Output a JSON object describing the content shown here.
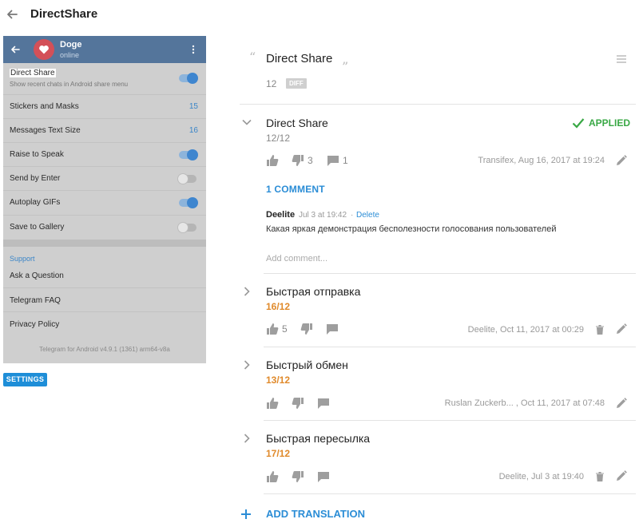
{
  "header": {
    "title": "DirectShare"
  },
  "phone": {
    "chat_name": "Doge",
    "chat_status": "online",
    "rows": [
      {
        "label": "Direct Share",
        "sub": "Show recent chats in Android share menu",
        "toggle": true
      },
      {
        "label": "Stickers and Masks",
        "value": "15"
      },
      {
        "label": "Messages Text Size",
        "value": "16"
      },
      {
        "label": "Raise to Speak",
        "toggle": true
      },
      {
        "label": "Send by Enter",
        "toggle": false
      },
      {
        "label": "Autoplay GIFs",
        "toggle": true
      },
      {
        "label": "Save to Gallery",
        "toggle": false
      }
    ],
    "section": "Support",
    "support_rows": [
      "Ask a Question",
      "Telegram FAQ",
      "Privacy Policy"
    ],
    "footer": "Telegram for Android v4.9.1 (1361) arm64-v8a"
  },
  "settings_button": "SETTINGS",
  "source": {
    "open_quote": "“",
    "close_quote": "”",
    "text": "Direct Share",
    "count": "12",
    "diff_label": "DIFF"
  },
  "translations": [
    {
      "text": "Direct Share",
      "count": "12/12",
      "status": "APPLIED",
      "likes": "",
      "dislikes": "3",
      "comments": "1",
      "meta": "Transifex, Aug 16, 2017 at 19:24",
      "comments_label": "1 COMMENT",
      "comment": {
        "author": "Deelite",
        "date": "Jul 3 at 19:42",
        "separator": "·",
        "delete_label": "Delete",
        "text": "Какая яркая демонстрация бесполезности голосования пользователей"
      },
      "add_comment_placeholder": "Add comment..."
    },
    {
      "text": "Быстрая отправка",
      "count": "16/12",
      "likes": "5",
      "dislikes": "",
      "comments": "",
      "meta": "Deelite, Oct 11, 2017 at 00:29"
    },
    {
      "text": "Быстрый обмен",
      "count": "13/12",
      "likes": "",
      "dislikes": "",
      "comments": "",
      "meta": "Ruslan Zuckerb... , Oct 11, 2017 at 07:48"
    },
    {
      "text": "Быстрая пересылка",
      "count": "17/12",
      "likes": "",
      "dislikes": "",
      "comments": "",
      "meta": "Deelite, Jul 3 at 19:40"
    }
  ],
  "add_translation_label": "ADD TRANSLATION",
  "colors": {
    "accent": "#2b8dd6",
    "applied": "#39a845",
    "over_limit": "#e08a2b",
    "phone_header": "#54759b"
  },
  "icons": [
    "back-arrow-icon",
    "heart-icon",
    "more-vert-icon",
    "menu-icon",
    "chevron-down-icon",
    "chevron-right-icon",
    "thumb-up-icon",
    "thumb-down-icon",
    "comment-icon",
    "pencil-icon",
    "trash-icon",
    "check-icon",
    "plus-icon"
  ]
}
